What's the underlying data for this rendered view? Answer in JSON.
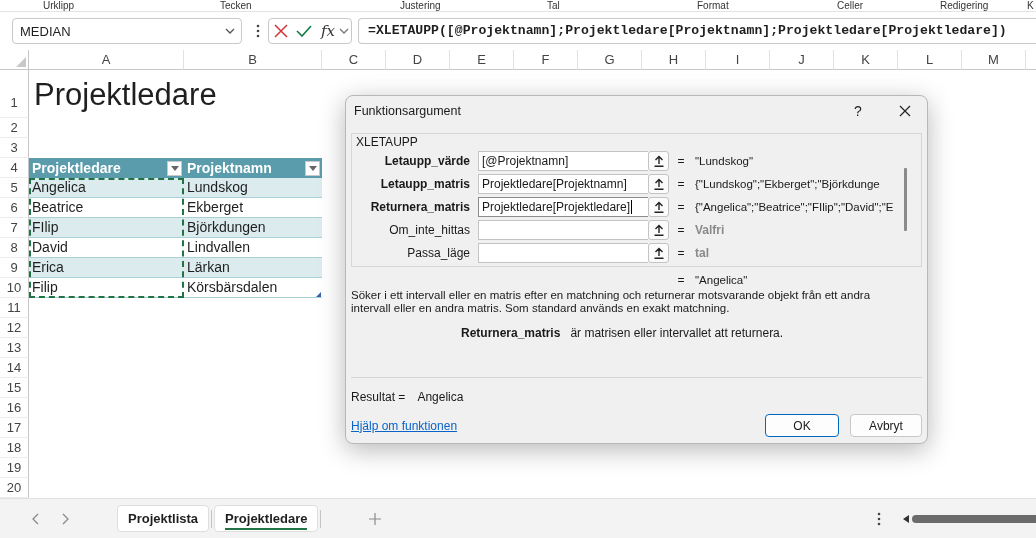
{
  "ribbon": {
    "group_labels": [
      "Urklipp",
      "Tecken",
      "Justering",
      "Tal",
      "Format",
      "Celler",
      "Redigering",
      "K"
    ]
  },
  "formula_bar": {
    "name_box": "MEDIAN",
    "function_button": "fx",
    "formula": "=XLETAUPP([@Projektnamn];Projektledare[Projektnamn];Projektledare[Projektledare])"
  },
  "sheet": {
    "column_headers": [
      "A",
      "B",
      "C",
      "D",
      "E",
      "F",
      "G",
      "H",
      "I",
      "J",
      "K",
      "L",
      "M"
    ],
    "row_headers": [
      "1",
      "2",
      "3",
      "4",
      "5",
      "6",
      "7",
      "8",
      "9",
      "10",
      "11",
      "12",
      "13",
      "14",
      "15",
      "16",
      "17",
      "18",
      "19",
      "20"
    ],
    "title": "Projektledare",
    "table": {
      "columns": [
        {
          "label": "Projektledare",
          "highlighted": true
        },
        {
          "label": "Projektnamn",
          "highlighted": false
        }
      ],
      "rows": [
        [
          "Angelica",
          "Lundskog"
        ],
        [
          "Beatrice",
          "Ekberget"
        ],
        [
          "FIlip",
          "Björkdungen"
        ],
        [
          "David",
          "Lindvallen"
        ],
        [
          "Erica",
          "Lärkan"
        ],
        [
          "Filip",
          "Körsbärsdalen"
        ]
      ]
    }
  },
  "dialog": {
    "title": "Funktionsargument",
    "help_button": "?",
    "function_name": "XLETAUPP",
    "arguments": [
      {
        "label": "Letaupp_värde",
        "required": true,
        "value": "[@Projektnamn]",
        "focused": false,
        "sign": "=",
        "result": "\"Lundskog\""
      },
      {
        "label": "Letaupp_matris",
        "required": true,
        "value": "Projektledare[Projektnamn]",
        "focused": false,
        "sign": "=",
        "result": "{\"Lundskog\";\"Ekberget\";\"Björkdunge"
      },
      {
        "label": "Returnera_matris",
        "required": true,
        "value": "Projektledare[Projektledare]",
        "focused": true,
        "sign": "=",
        "result": "{\"Angelica\";\"Beatrice\";\"FIlip\";\"David\";\"E"
      },
      {
        "label": "Om_inte_hittas",
        "required": false,
        "focused": false,
        "sign": "=",
        "result": "Valfri"
      },
      {
        "label": "Passa_läge",
        "required": false,
        "focused": false,
        "sign": "=",
        "result": "tal"
      }
    ],
    "formula_result": {
      "sign": "=",
      "value": "\"Angelica\""
    },
    "description": "Söker i ett intervall eller en matris efter en matchning och returnerar motsvarande objekt från ett andra intervall eller en andra matris. Som standard används en exakt matchning.",
    "argument_help": {
      "name": "Returnera_matris",
      "text": "är matrisen eller intervallet att returnera."
    },
    "result": {
      "label": "Resultat =",
      "value": "Angelica"
    },
    "help_link": "Hjälp om funktionen",
    "buttons": [
      {
        "label": "OK",
        "default": true
      },
      {
        "label": "Avbryt",
        "default": false
      }
    ]
  },
  "sheet_tabs": [
    {
      "label": "Projektlista",
      "selected": false
    },
    {
      "label": "Projektledare",
      "selected": true
    }
  ]
}
